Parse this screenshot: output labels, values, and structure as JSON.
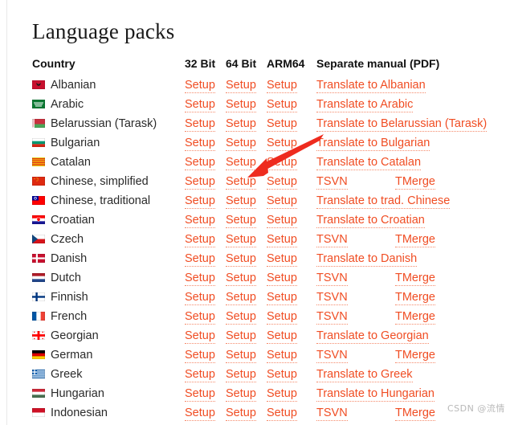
{
  "page": {
    "title": "Language packs",
    "watermark": "CSDN @流情"
  },
  "table": {
    "headers": {
      "country": "Country",
      "bit32": "32 Bit",
      "bit64": "64 Bit",
      "arm64": "ARM64",
      "manual": "Separate manual (PDF)"
    },
    "setup_label": "Setup",
    "rows": [
      {
        "country": "Albanian",
        "flag": "flag-albania",
        "bit32": "Setup",
        "bit64": "Setup",
        "arm64": "Setup",
        "manual_type": "single",
        "manual": "Translate to Albanian"
      },
      {
        "country": "Arabic",
        "flag": "flag-arabic",
        "bit32": "Setup",
        "bit64": "Setup",
        "arm64": "Setup",
        "manual_type": "single",
        "manual": "Translate to Arabic"
      },
      {
        "country": "Belarussian (Tarask)",
        "flag": "flag-belarus",
        "bit32": "Setup",
        "bit64": "Setup",
        "arm64": "Setup",
        "manual_type": "single",
        "manual": "Translate to Belarussian (Tarask)"
      },
      {
        "country": "Bulgarian",
        "flag": "flag-bulgaria",
        "bit32": "Setup",
        "bit64": "Setup",
        "arm64": "Setup",
        "manual_type": "single",
        "manual": "Translate to Bulgarian"
      },
      {
        "country": "Catalan",
        "flag": "flag-catalonia",
        "bit32": "Setup",
        "bit64": "Setup",
        "arm64": "Setup",
        "manual_type": "single",
        "manual": "Translate to Catalan"
      },
      {
        "country": "Chinese, simplified",
        "flag": "flag-china",
        "bit32": "Setup",
        "bit64": "Setup",
        "arm64": "Setup",
        "manual_type": "pair",
        "manual_tsvn": "TSVN",
        "manual_tmerge": "TMerge"
      },
      {
        "country": "Chinese, traditional",
        "flag": "flag-taiwan",
        "bit32": "Setup",
        "bit64": "Setup",
        "arm64": "Setup",
        "manual_type": "single",
        "manual": "Translate to trad. Chinese"
      },
      {
        "country": "Croatian",
        "flag": "flag-croatia",
        "bit32": "Setup",
        "bit64": "Setup",
        "arm64": "Setup",
        "manual_type": "single",
        "manual": "Translate to Croatian"
      },
      {
        "country": "Czech",
        "flag": "flag-czech",
        "bit32": "Setup",
        "bit64": "Setup",
        "arm64": "Setup",
        "manual_type": "pair",
        "manual_tsvn": "TSVN",
        "manual_tmerge": "TMerge"
      },
      {
        "country": "Danish",
        "flag": "flag-denmark",
        "bit32": "Setup",
        "bit64": "Setup",
        "arm64": "Setup",
        "manual_type": "single",
        "manual": "Translate to Danish"
      },
      {
        "country": "Dutch",
        "flag": "flag-netherlands",
        "bit32": "Setup",
        "bit64": "Setup",
        "arm64": "Setup",
        "manual_type": "pair",
        "manual_tsvn": "TSVN",
        "manual_tmerge": "TMerge"
      },
      {
        "country": "Finnish",
        "flag": "flag-finland",
        "bit32": "Setup",
        "bit64": "Setup",
        "arm64": "Setup",
        "manual_type": "pair",
        "manual_tsvn": "TSVN",
        "manual_tmerge": "TMerge"
      },
      {
        "country": "French",
        "flag": "flag-france",
        "bit32": "Setup",
        "bit64": "Setup",
        "arm64": "Setup",
        "manual_type": "pair",
        "manual_tsvn": "TSVN",
        "manual_tmerge": "TMerge"
      },
      {
        "country": "Georgian",
        "flag": "flag-georgia",
        "bit32": "Setup",
        "bit64": "Setup",
        "arm64": "Setup",
        "manual_type": "single",
        "manual": "Translate to Georgian"
      },
      {
        "country": "German",
        "flag": "flag-germany",
        "bit32": "Setup",
        "bit64": "Setup",
        "arm64": "Setup",
        "manual_type": "pair",
        "manual_tsvn": "TSVN",
        "manual_tmerge": "TMerge"
      },
      {
        "country": "Greek",
        "flag": "flag-greece",
        "bit32": "Setup",
        "bit64": "Setup",
        "arm64": "Setup",
        "manual_type": "single",
        "manual": "Translate to Greek"
      },
      {
        "country": "Hungarian",
        "flag": "flag-hungary",
        "bit32": "Setup",
        "bit64": "Setup",
        "arm64": "Setup",
        "manual_type": "single",
        "manual": "Translate to Hungarian"
      },
      {
        "country": "Indonesian",
        "flag": "flag-indonesia",
        "bit32": "Setup",
        "bit64": "Setup",
        "arm64": "Setup",
        "manual_type": "pair",
        "manual_tsvn": "TSVN",
        "manual_tmerge": "TMerge"
      }
    ]
  },
  "annotation": {
    "type": "arrow",
    "color": "#ee2b1e",
    "points_to": "64 Bit Setup link of Chinese, simplified row"
  },
  "colors": {
    "link": "#f04d23",
    "text": "#2a2a2a",
    "heading": "#111111",
    "arrow": "#ee2b1e",
    "watermark": "#b9b9b9"
  }
}
